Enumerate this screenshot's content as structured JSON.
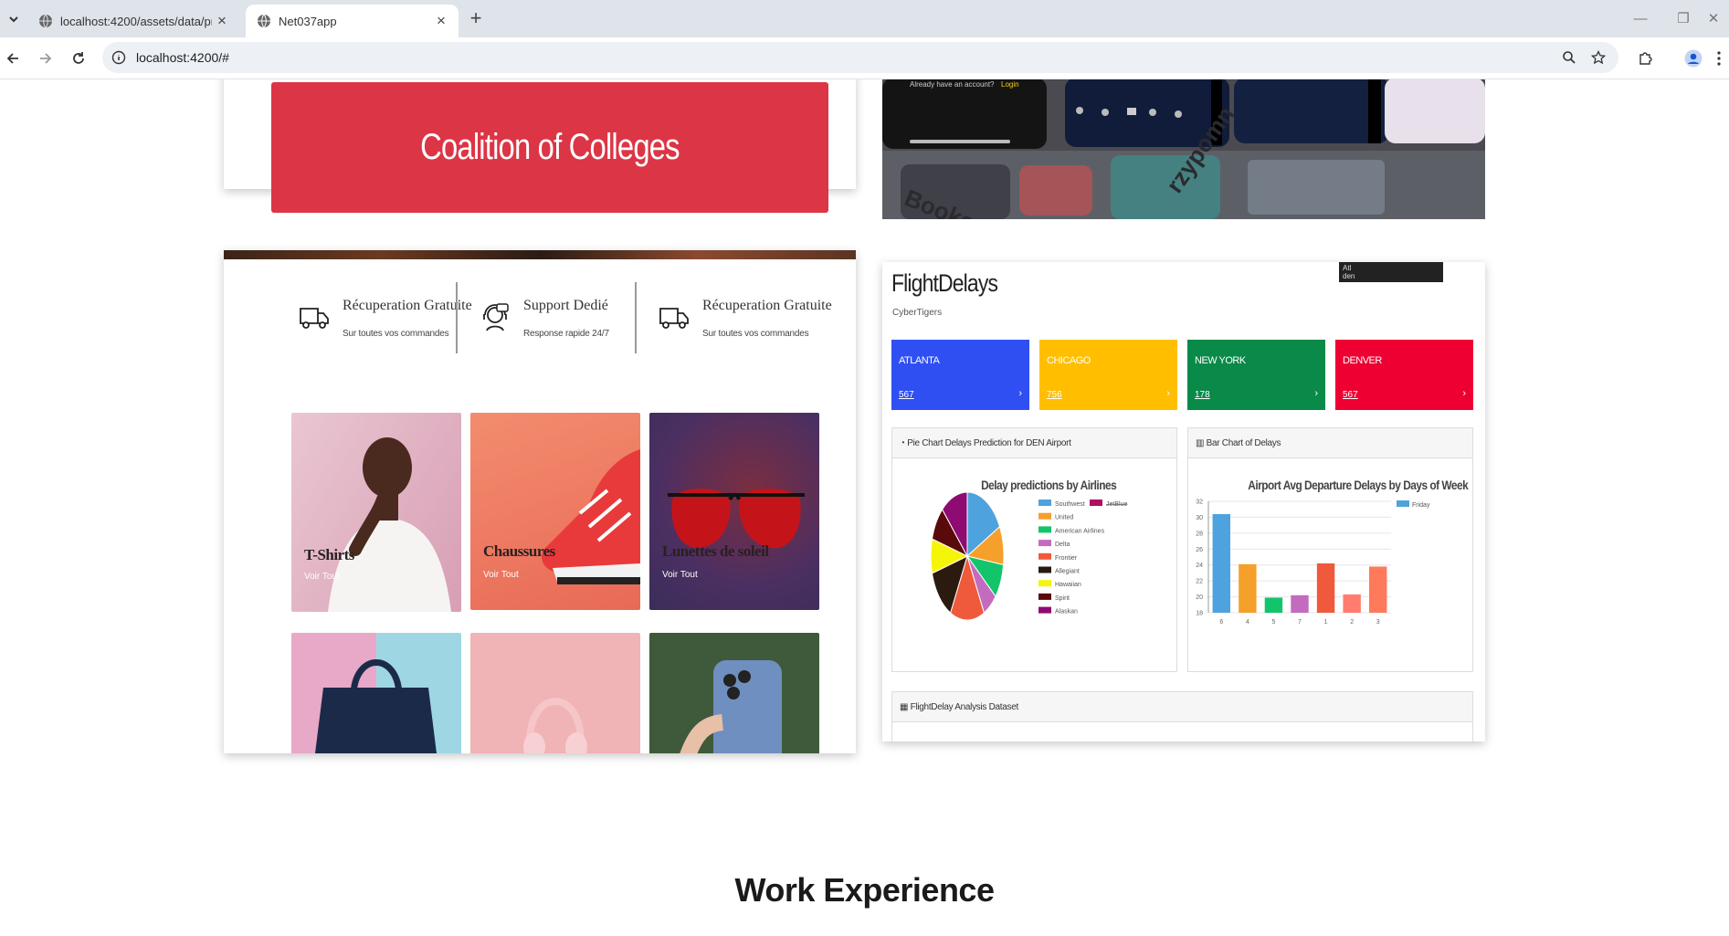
{
  "browser": {
    "tabs": [
      {
        "title": "localhost:4200/assets/data/pro",
        "active": false
      },
      {
        "title": "Net037app",
        "active": true
      }
    ],
    "url": "localhost:4200/#"
  },
  "coalition": {
    "label": "Coalition of Colleges",
    "color": "#dc3545"
  },
  "shop": {
    "features": [
      {
        "title": "Récuperation Gratuite",
        "subtitle": "Sur toutes vos commandes",
        "icon": "delivery-truck-icon"
      },
      {
        "title": "Support Dedié",
        "subtitle": "Response rapide 24/7",
        "icon": "support-agent-icon"
      },
      {
        "title": "Récuperation Gratuite",
        "subtitle": "Sur toutes vos commandes",
        "icon": "delivery-truck-icon"
      }
    ],
    "categories": [
      {
        "name": "T-Shirts",
        "link": "Voir Tout"
      },
      {
        "name": "Chaussures",
        "link": "Voir Tout"
      },
      {
        "name": "Lunettes de soleil",
        "link": "Voir Tout"
      }
    ]
  },
  "flight": {
    "title": "FlightDelays",
    "subtitle": "CyberTigers",
    "tooltip": [
      "Atl",
      "den"
    ],
    "kpis": [
      {
        "city": "ATLANTA",
        "value": "567",
        "color": "#2f4ff2"
      },
      {
        "city": "CHICAGO",
        "value": "756",
        "color": "#ffbf00"
      },
      {
        "city": "NEW YORK",
        "value": "178",
        "color": "#0a8a48"
      },
      {
        "city": "DENVER",
        "value": "567",
        "color": "#ee0033"
      }
    ],
    "pie_panel": "Pie Chart Delays Prediction for DEN Airport",
    "bar_panel": "Bar Chart of Delays",
    "dataset_panel": "FlightDelay Analysis Dataset"
  },
  "chart_data": [
    {
      "type": "pie",
      "title": "Delay predictions by Airlines",
      "categories": [
        "Southwest",
        "United",
        "American Airlines",
        "Delta",
        "Frontier",
        "Allegiant",
        "Hawaiian",
        "Spirit",
        "Alaskan",
        "JetBlue"
      ],
      "values": [
        16,
        9,
        8,
        6,
        14,
        12,
        8,
        8,
        11,
        8
      ],
      "colors": [
        "#4ea3de",
        "#f5a02a",
        "#12c46a",
        "#c36cbf",
        "#ef5a3c",
        "#2a1a10",
        "#f5f50a",
        "#5a0a0a",
        "#8e0b72",
        "#b01060"
      ],
      "hidden": [
        "JetBlue"
      ],
      "legend_position": "right"
    },
    {
      "type": "bar",
      "title": "Airport Avg Departure Delays by Days of Week",
      "categories": [
        "6",
        "4",
        "5",
        "7",
        "1",
        "2",
        "3"
      ],
      "values": [
        30.4,
        24.1,
        19.9,
        20.2,
        24.2,
        20.3,
        23.8
      ],
      "colors": [
        "#4ea3de",
        "#f5a02a",
        "#12c46a",
        "#c36cbf",
        "#ef5a3c",
        "#ff7c6e",
        "#ff7a5a"
      ],
      "series": [
        {
          "name": "Friday"
        }
      ],
      "ylim": [
        18,
        32
      ],
      "yticks": [
        "18",
        "20",
        "22",
        "24",
        "26",
        "28",
        "30",
        "32"
      ],
      "legend_position": "top-right"
    }
  ],
  "section": {
    "title": "Work Experience"
  }
}
